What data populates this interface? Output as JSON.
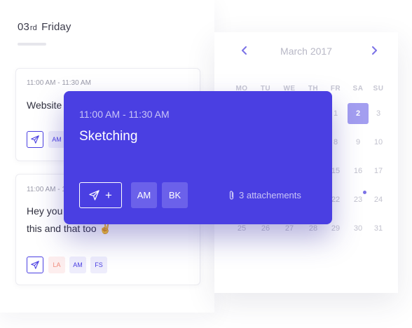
{
  "day": {
    "date_num": "03",
    "date_suffix": "rd",
    "weekday": "Friday"
  },
  "cards": [
    {
      "time": "11:00 AM - 11:30 AM",
      "text_line1": "Website d",
      "tags": [
        "AM"
      ]
    },
    {
      "time": "11:00 AM - 11:30 AM",
      "text_line1": "Hey you",
      "text_line2": "this and that too ✌",
      "tags": [
        "LA",
        "AM",
        "FS"
      ]
    }
  ],
  "calendar": {
    "month_label": "March 2017",
    "weekdays": [
      "MO",
      "TU",
      "WE",
      "TH",
      "FR",
      "SA",
      "SU"
    ],
    "weeks": [
      [
        "",
        "",
        "",
        "",
        "1",
        "2",
        "3"
      ],
      [
        "",
        "",
        "",
        "",
        "8",
        "9",
        "10"
      ],
      [
        "",
        "",
        "",
        "",
        "15",
        "16",
        "17"
      ],
      [
        "",
        "",
        "",
        "",
        "22",
        "23",
        "24"
      ],
      [
        "25",
        "26",
        "27",
        "28",
        "29",
        "30",
        "31"
      ]
    ],
    "selected_day": "2",
    "event_dot_day": "23"
  },
  "popover": {
    "time": "11:00 AM - 11:30 AM",
    "title": "Sketching",
    "add_symbol": "+",
    "tags": [
      "AM",
      "BK"
    ],
    "attachments": "3 attachements"
  },
  "icons": {
    "send": "send-icon",
    "paperclip": "paperclip-icon",
    "chevron_left": "chevron-left-icon",
    "chevron_right": "chevron-right-icon"
  },
  "colors": {
    "accent": "#4a3fe2",
    "selected_day": "#a39ef0",
    "tag_bg": "#eeedfc",
    "tag_pink_bg": "#fdeeee"
  }
}
